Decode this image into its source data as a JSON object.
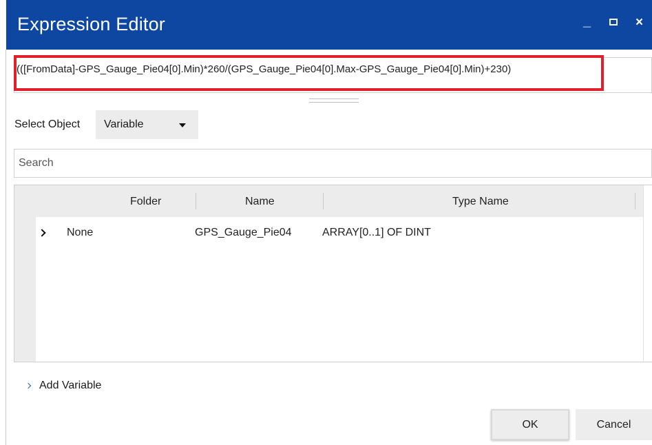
{
  "window": {
    "title": "Expression Editor",
    "minimize_glyph": "_",
    "close_glyph": "×",
    "colors": {
      "titlebar": "#0d47a1",
      "highlight": "#e0202a"
    }
  },
  "expression": {
    "value": "(([FromData]-GPS_Gauge_Pie04[0].Min)*260/(GPS_Gauge_Pie04[0].Max-GPS_Gauge_Pie04[0].Min)+230)"
  },
  "select_object": {
    "label": "Select Object",
    "value": "Variable"
  },
  "search": {
    "placeholder": "Search"
  },
  "table": {
    "columns": [
      "Folder",
      "Name",
      "Type Name"
    ],
    "rows": [
      {
        "folder": "None",
        "name": "GPS_Gauge_Pie04",
        "type": "ARRAY[0..1] OF DINT"
      }
    ]
  },
  "add_variable": {
    "label": "Add Variable"
  },
  "buttons": {
    "ok": "OK",
    "cancel": "Cancel"
  }
}
